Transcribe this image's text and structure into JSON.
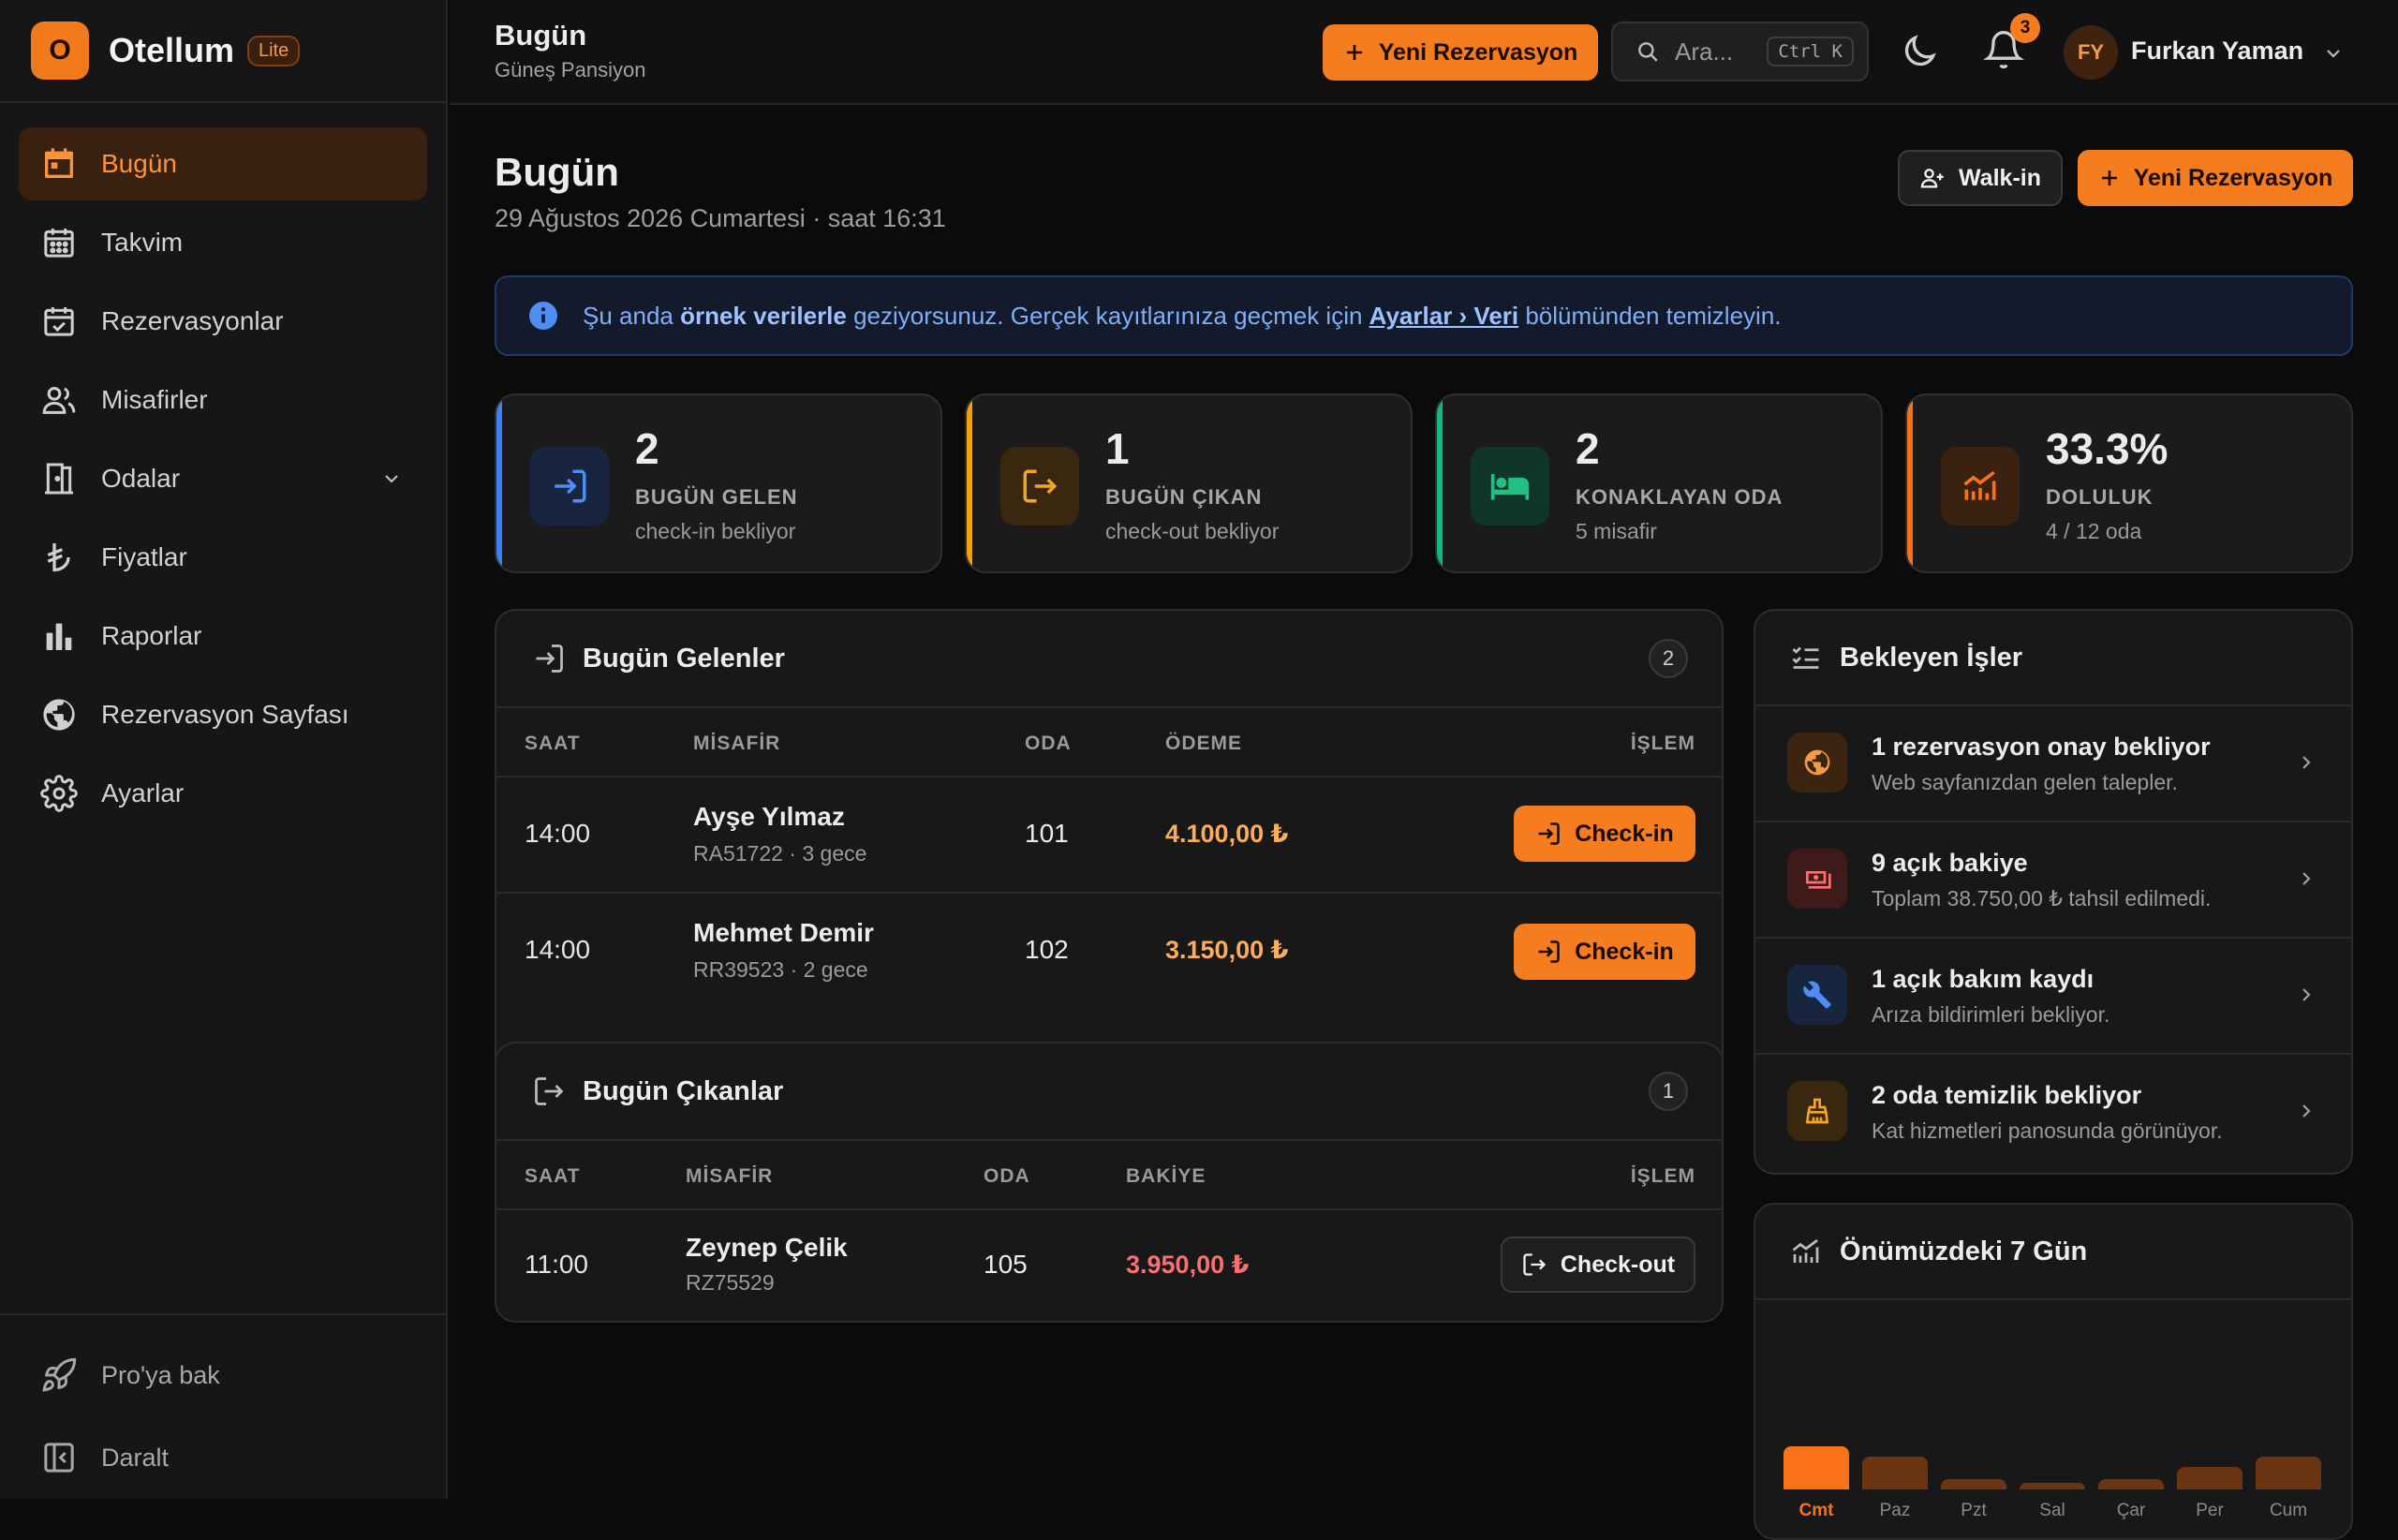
{
  "app": {
    "name": "Otellum",
    "plan_badge": "Lite"
  },
  "sidebar": {
    "items": [
      {
        "label": "Bugün",
        "icon": "calendar-today-icon",
        "active": true
      },
      {
        "label": "Takvim",
        "icon": "calendar-icon"
      },
      {
        "label": "Rezervasyonlar",
        "icon": "calendar-check-icon"
      },
      {
        "label": "Misafirler",
        "icon": "users-icon"
      },
      {
        "label": "Odalar",
        "icon": "door-icon",
        "expandable": true
      },
      {
        "label": "Fiyatlar",
        "icon": "lira-icon"
      },
      {
        "label": "Raporlar",
        "icon": "bar-chart-icon"
      },
      {
        "label": "Rezervasyon Sayfası",
        "icon": "globe-icon"
      },
      {
        "label": "Ayarlar",
        "icon": "gear-icon"
      }
    ],
    "footer": [
      {
        "label": "Pro'ya bak",
        "icon": "rocket-icon"
      },
      {
        "label": "Daralt",
        "icon": "collapse-icon"
      }
    ]
  },
  "topbar": {
    "title": "Bugün",
    "subtitle": "Güneş Pansiyon",
    "new_reservation": "Yeni Rezervasyon",
    "search_placeholder": "Ara...",
    "search_shortcut": "Ctrl K",
    "notification_count": "3",
    "user_initials": "FY",
    "user_name": "Furkan Yaman"
  },
  "page": {
    "title": "Bugün",
    "date": "29 Ağustos 2026 Cumartesi · saat 16:31",
    "walkin_label": "Walk-in",
    "new_reservation": "Yeni Rezervasyon"
  },
  "info_banner": {
    "prefix": "Şu anda ",
    "bold": "örnek verilerle",
    "middle": " geziyorsunuz. Gerçek kayıtlarınıza geçmek için ",
    "link": "Ayarlar › Veri",
    "suffix": " bölümünden temizleyin."
  },
  "stats": [
    {
      "value": "2",
      "label": "BUGÜN GELEN",
      "sub": "check-in bekliyor",
      "color": "#3b82f6"
    },
    {
      "value": "1",
      "label": "BUGÜN ÇIKAN",
      "sub": "check-out bekliyor",
      "color": "#f59e0b"
    },
    {
      "value": "2",
      "label": "KONAKLAYAN ODA",
      "sub": "5 misafir",
      "color": "#10b981"
    },
    {
      "value": "33.3%",
      "label": "DOLULUK",
      "sub": "4 / 12 oda",
      "color": "#f97316"
    }
  ],
  "arrivals": {
    "title": "Bugün Gelenler",
    "count": "2",
    "columns": [
      "SAAT",
      "MİSAFİR",
      "ODA",
      "ÖDEME",
      "İŞLEM"
    ],
    "rows": [
      {
        "time": "14:00",
        "name": "Ayşe Yılmaz",
        "ref": "RA51722 · 3 gece",
        "room": "101",
        "amount": "4.100,00 ₺",
        "action": "Check-in"
      },
      {
        "time": "14:00",
        "name": "Mehmet Demir",
        "ref": "RR39523 · 2 gece",
        "room": "102",
        "amount": "3.150,00 ₺",
        "action": "Check-in"
      }
    ]
  },
  "departures": {
    "title": "Bugün Çıkanlar",
    "count": "1",
    "columns": [
      "SAAT",
      "MİSAFİR",
      "ODA",
      "BAKİYE",
      "İŞLEM"
    ],
    "rows": [
      {
        "time": "11:00",
        "name": "Zeynep Çelik",
        "ref": "RZ75529",
        "room": "105",
        "amount": "3.950,00 ₺",
        "action": "Check-out"
      }
    ]
  },
  "pending": {
    "title": "Bekleyen İşler",
    "items": [
      {
        "title": "1 rezervasyon onay bekliyor",
        "sub": "Web sayfanızdan gelen talepler.",
        "icon": "globe-icon"
      },
      {
        "title": "9 açık bakiye",
        "sub": "Toplam 38.750,00 ₺ tahsil edilmedi.",
        "icon": "cash-icon"
      },
      {
        "title": "1 açık bakım kaydı",
        "sub": "Arıza bildirimleri bekliyor.",
        "icon": "wrench-icon"
      },
      {
        "title": "2 oda temizlik bekliyor",
        "sub": "Kat hizmetleri panosunda görünüyor.",
        "icon": "broom-icon"
      }
    ]
  },
  "week": {
    "title": "Önümüzdeki 7 Gün",
    "days": [
      {
        "label": "Cmt",
        "level": 0.33,
        "today": true
      },
      {
        "label": "Paz",
        "level": 0.25
      },
      {
        "label": "Pzt",
        "level": 0.08
      },
      {
        "label": "Sal",
        "level": 0.05
      },
      {
        "label": "Çar",
        "level": 0.08
      },
      {
        "label": "Per",
        "level": 0.17
      },
      {
        "label": "Cum",
        "level": 0.25
      }
    ]
  }
}
